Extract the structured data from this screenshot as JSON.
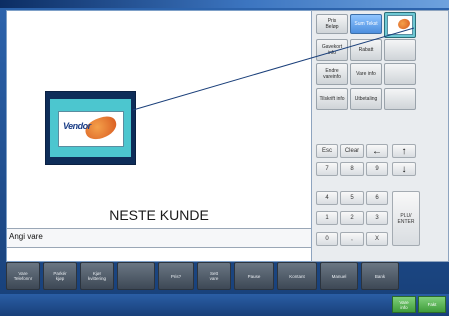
{
  "message": "NESTE KUNDE",
  "input": {
    "label": "Angi vare"
  },
  "card": {
    "brand": "Vendor"
  },
  "function_buttons": [
    {
      "id": "f1",
      "label": "Pris\nBeløp"
    },
    {
      "id": "f2",
      "label": "Sum Tekst"
    },
    {
      "id": "f4",
      "label": "Gavekort\ninfo"
    },
    {
      "id": "f5",
      "label": "Rabatt"
    },
    {
      "id": "f7",
      "label": "Endre vareinfo"
    },
    {
      "id": "f8",
      "label": "Vare info"
    },
    {
      "id": "f10",
      "label": "Tilskrift info"
    },
    {
      "id": "f11",
      "label": "Utbetaling"
    }
  ],
  "keypad": {
    "top": [
      "Esc",
      "Clear"
    ],
    "rows": [
      [
        "7",
        "8",
        "9"
      ],
      [
        "4",
        "5",
        "6"
      ],
      [
        "1",
        "2",
        "3"
      ],
      [
        "0",
        ",",
        "X"
      ]
    ],
    "enter": "PLU/\nENTER"
  },
  "bottom_buttons": [
    "Vare\nTelefonnr",
    "Parkér\nkjøp",
    "Kjør\nkvittering",
    "",
    "Pris?",
    "Sett\nvare",
    "Pause",
    "Kontant",
    "Manuel",
    "Bank"
  ],
  "status_buttons": [
    "Vare\ninfo",
    "Fakt"
  ],
  "colors": {
    "accent_blue": "#4c8ede",
    "thumb_bg": "#4cc6cf",
    "frame_dark": "#0e2d59"
  },
  "icons": {
    "arrow_left": "←",
    "arrow_up": "↑",
    "arrow_down": "↓",
    "card_logo": "vendor-card-icon"
  }
}
